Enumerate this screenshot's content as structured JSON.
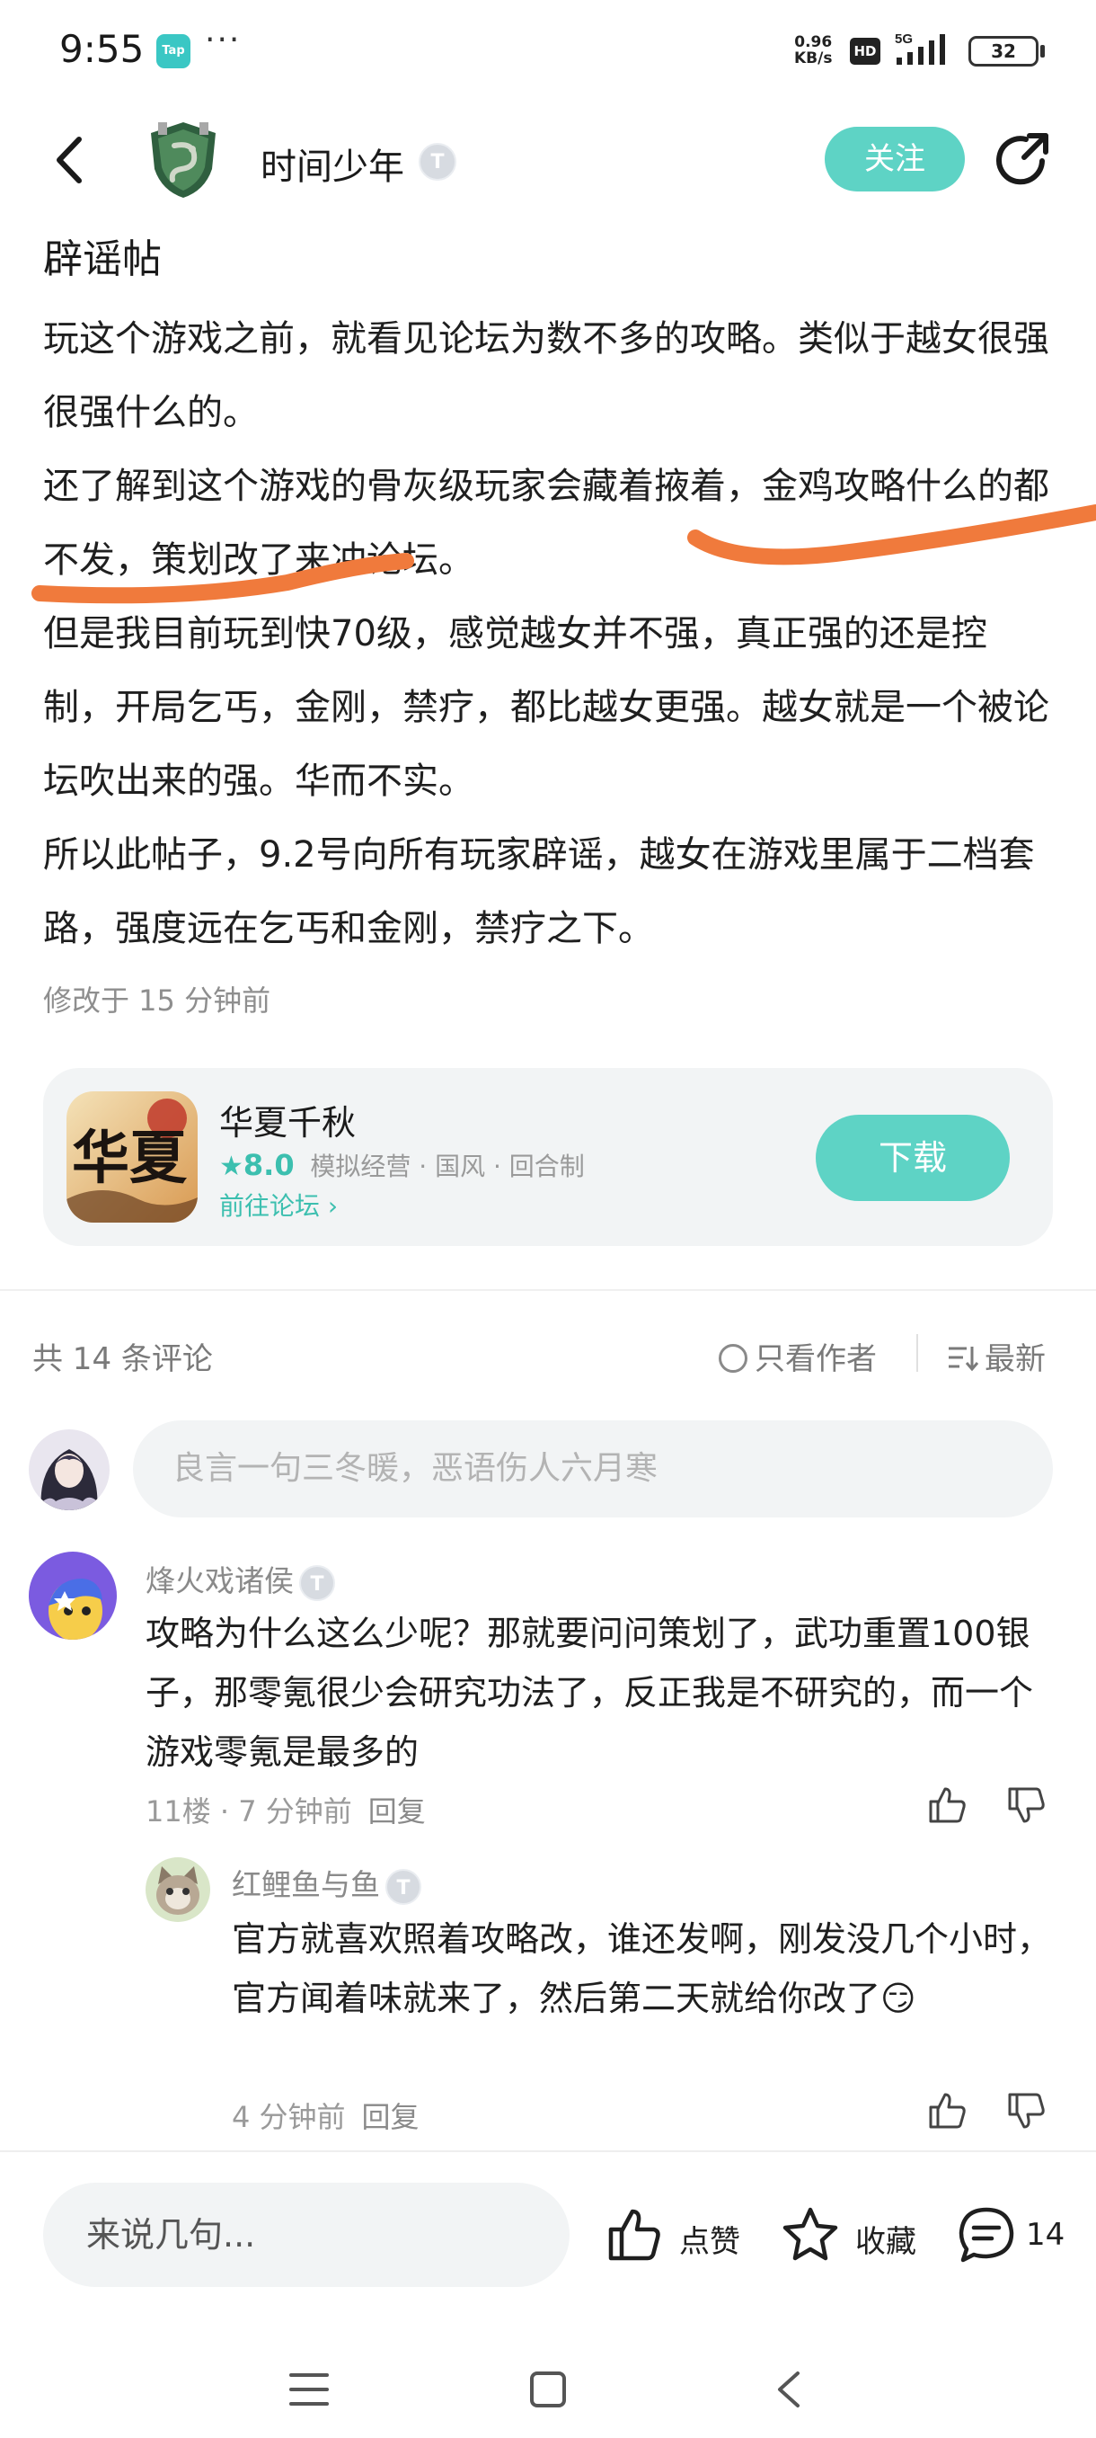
{
  "status_bar": {
    "time": "9:55",
    "tap_label": "Tap",
    "dots": "···",
    "net_speed_value": "0.96",
    "net_speed_unit": "KB/s",
    "hd_label": "HD",
    "network_label": "5G",
    "battery": "32"
  },
  "header": {
    "author_name": "时间少年",
    "follow_label": "关注"
  },
  "post": {
    "title": "辟谣帖",
    "paragraphs": [
      "玩这个游戏之前，就看见论坛为数不多的攻略。类似于越女很强很强什么的。",
      "还了解到这个游戏的骨灰级玩家会藏着掖着，金鸡攻略什么的都不发，策划改了来冲论坛。",
      "但是我目前玩到快70级，感觉越女并不强，真正强的还是控制，开局乞丐，金刚，禁疗，都比越女更强。越女就是一个被论坛吹出来的强。华而不实。",
      "所以此帖子，9.2号向所有玩家辟谣，越女在游戏里属于二档套路，强度远在乞丐和金刚，禁疗之下。"
    ],
    "edited": "修改于 15 分钟前"
  },
  "game_card": {
    "icon_text": "华夏",
    "name": "华夏千秋",
    "star": "★",
    "score": "8.0",
    "tags": "模拟经营 · 国风 · 回合制",
    "forum_link": "前往论坛",
    "forum_chevron": "›",
    "download_label": "下载"
  },
  "comments_header": {
    "count": "共 14 条评论",
    "author_only": "只看作者",
    "sort": "最新"
  },
  "comment_input": {
    "placeholder": "良言一句三冬暖，恶语伤人六月寒"
  },
  "comments": [
    {
      "name": "烽火戏诸侯",
      "text": "攻略为什么这么少呢？那就要问问策划了，武功重置100银子，那零氪很少会研究功法了，反正我是不研究的，而一个游戏零氪是最多的",
      "meta": "11楼 · 7 分钟前",
      "reply_label": "回复"
    },
    {
      "name": "红鲤鱼与鱼",
      "text": "官方就喜欢照着攻略改，谁还发啊，刚发没几个小时，官方闻着味就来了，然后第二天就给你改了😏",
      "meta": "4 分钟前",
      "reply_label": "回复"
    }
  ],
  "bottom_bar": {
    "input_placeholder": "来说几句...",
    "like_label": "点赞",
    "favorite_label": "收藏",
    "comment_count": "14"
  },
  "colors": {
    "accent": "#5ed3c5",
    "accent_text": "#3cbfaf",
    "annotation_orange": "#f07a3c"
  },
  "icons": [
    "back-arrow-icon",
    "share-icon",
    "star-icon",
    "chevron-right-icon",
    "sort-icon",
    "thumb-up-icon",
    "thumb-down-icon",
    "like-icon",
    "favorite-star-icon",
    "comment-bubble-icon",
    "nav-menu-icon",
    "nav-home-icon",
    "nav-back-icon"
  ]
}
